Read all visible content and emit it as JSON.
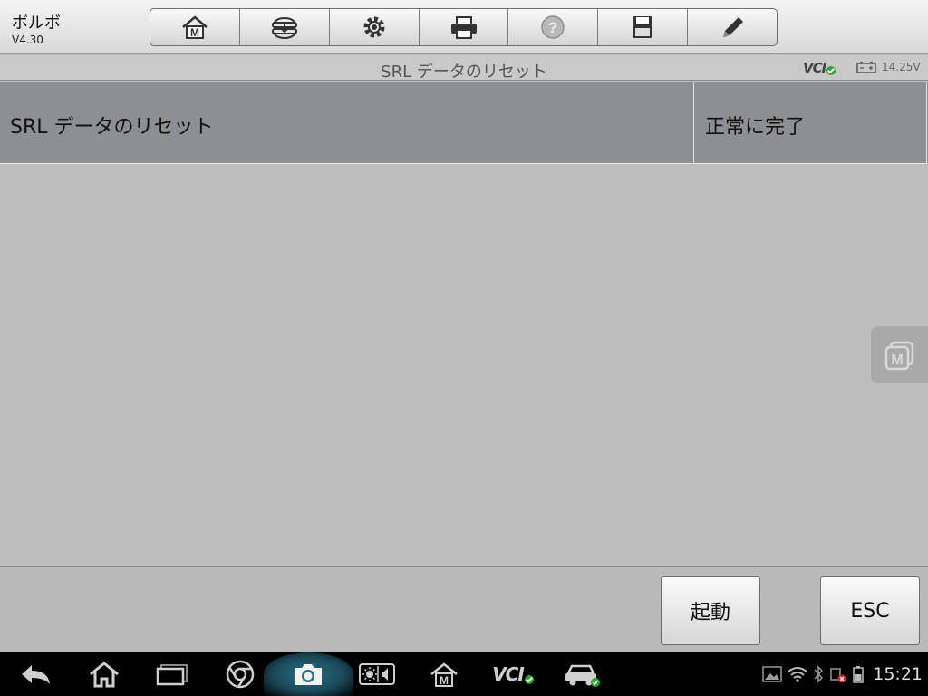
{
  "header": {
    "app_title": "ボルボ",
    "app_version": "V4.30",
    "toolbar": [
      {
        "name": "home-icon",
        "label": "Home"
      },
      {
        "name": "vehicle-swap-icon",
        "label": "Vehicle Swap"
      },
      {
        "name": "settings-icon",
        "label": "Settings"
      },
      {
        "name": "print-icon",
        "label": "Print"
      },
      {
        "name": "help-icon",
        "label": "Help"
      },
      {
        "name": "save-icon",
        "label": "Save"
      },
      {
        "name": "edit-icon",
        "label": "Edit"
      }
    ]
  },
  "sub_header": {
    "title": "SRL データのリセット",
    "vci_label": "VCI",
    "battery_voltage": "14.25V"
  },
  "result": {
    "name": "SRL データのリセット",
    "status": "正常に完了"
  },
  "footer": {
    "start_label": "起動",
    "esc_label": "ESC"
  },
  "system_bar": {
    "vci_label": "VCI",
    "time": "15:21"
  },
  "colors": {
    "accent_green": "#2fa52f",
    "table_bg": "#8e8f91",
    "page_bg": "#bdbdbd"
  }
}
